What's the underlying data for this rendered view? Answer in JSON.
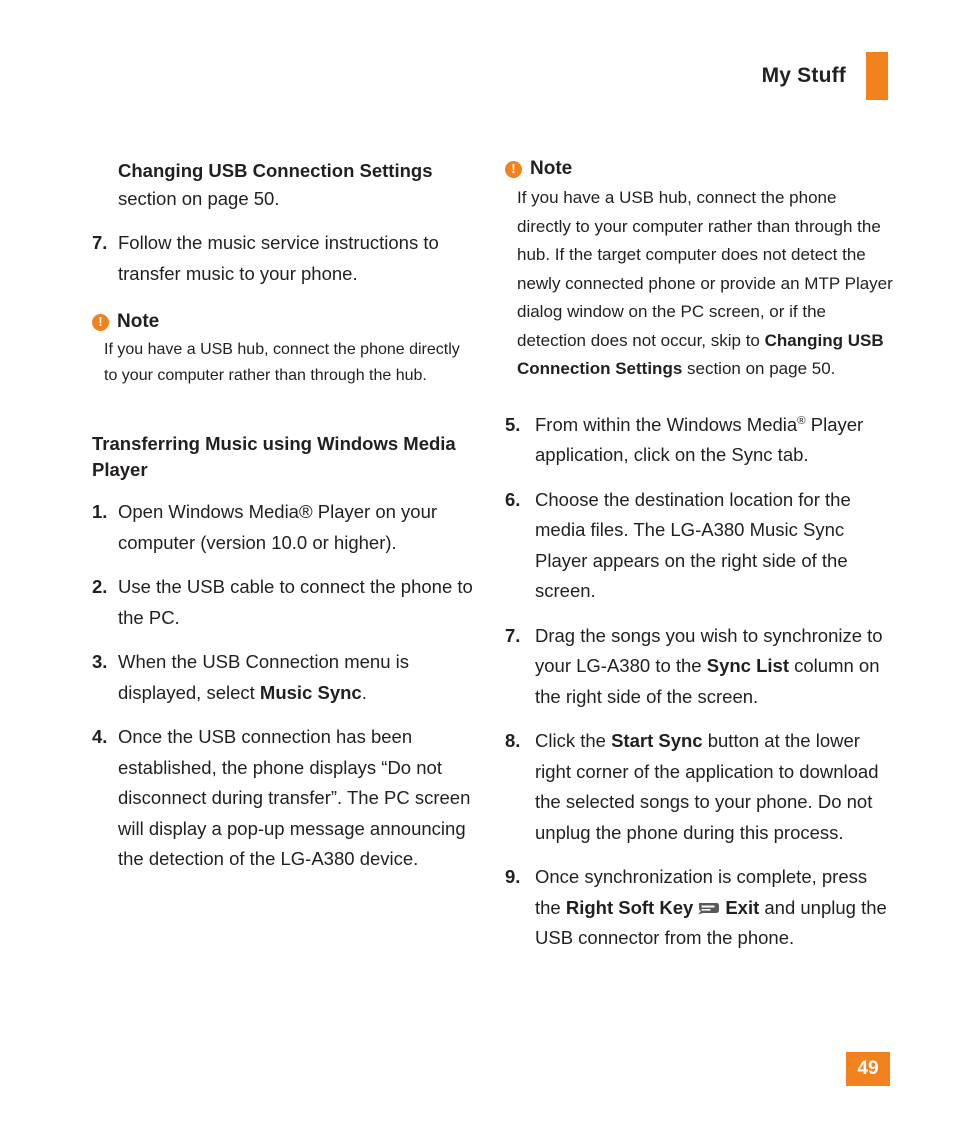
{
  "header": {
    "title": "My Stuff"
  },
  "left_column": {
    "continued_heading": "Changing USB Connection Settings",
    "continued_text": "section on page 50.",
    "item7": {
      "num": "7.",
      "text": "Follow the music service instructions to transfer music to your phone."
    },
    "note": {
      "icon": "!",
      "label": "Note",
      "text": "If you have a USB hub, connect the phone directly to your computer rather than through the hub."
    },
    "section_heading": "Transferring Music using Windows Media Player",
    "items": [
      {
        "num": "1.",
        "text": "Open Windows Media® Player on your computer (version 10.0 or higher)."
      },
      {
        "num": "2.",
        "text": "Use the USB cable to connect the phone to the PC."
      },
      {
        "num": "3.",
        "text_before": "When the USB Connection menu is displayed, select ",
        "bold": "Music Sync",
        "text_after": "."
      },
      {
        "num": "4.",
        "text": "Once the USB connection has been established, the phone displays “Do not disconnect during transfer”. The PC screen will display a pop-up message announcing the detection of the LG-A380 device."
      }
    ]
  },
  "right_column": {
    "note": {
      "icon": "!",
      "label": "Note",
      "text_before": "If you have a USB hub, connect the phone directly to your computer rather than through the hub. If the target computer does not detect the newly connected phone or provide an MTP Player dialog window on the PC screen, or if the detection does not occur, skip to ",
      "bold": "Changing USB Connection Settings",
      "text_after": " section on page 50."
    },
    "items": [
      {
        "num": "5.",
        "text_before": "From within the Windows Media",
        "sup": "®",
        "text_after": " Player application, click on the Sync tab."
      },
      {
        "num": "6.",
        "text": "Choose the destination location for the media files. The LG-A380 Music Sync Player appears on the right side of the screen."
      },
      {
        "num": "7.",
        "text_before": "Drag the songs you wish to synchronize to your LG-A380 to the ",
        "bold": "Sync List",
        "text_after": " column on the right side of the screen."
      },
      {
        "num": "8.",
        "text_before": "Click the ",
        "bold": "Start Sync",
        "text_after": " button at the lower right corner of the application to download the selected songs to your phone. Do not unplug the phone during this process."
      },
      {
        "num": "9.",
        "text_before": "Once synchronization is complete, press the ",
        "bold": "Right Soft Key",
        "icon": "soft-key-icon",
        "bold2": "Exit",
        "text_after": " and unplug the USB connector from the phone."
      }
    ]
  },
  "footer": {
    "page_number": "49"
  },
  "colors": {
    "accent": "#f2821d",
    "text": "#231f20"
  }
}
